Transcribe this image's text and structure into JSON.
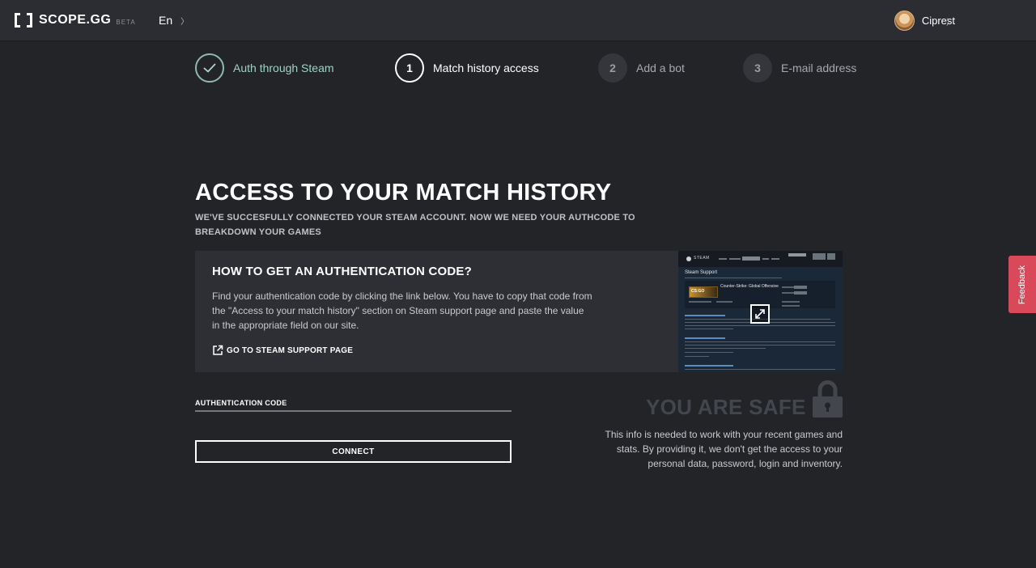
{
  "header": {
    "logo_text": "SCOPE.GG",
    "logo_badge": "BETA",
    "language": "En",
    "username": "Ciprest"
  },
  "steps": [
    {
      "number": "",
      "label": "Auth through Steam",
      "state": "done"
    },
    {
      "number": "1",
      "label": "Match history access",
      "state": "active"
    },
    {
      "number": "2",
      "label": "Add a bot",
      "state": "todo"
    },
    {
      "number": "3",
      "label": "E-mail address",
      "state": "todo"
    }
  ],
  "main": {
    "title": "ACCESS TO YOUR MATCH HISTORY",
    "subtitle": "WE'VE SUCCESFULLY CONNECTED YOUR STEAM ACCOUNT. NOW WE NEED YOUR AUTHCODE TO BREAKDOWN YOUR GAMES"
  },
  "card": {
    "title": "HOW TO GET AN AUTHENTICATION CODE?",
    "text": "Find your authentication code by clicking the link below. You have to copy that code from the \"Access to your match history\" section on Steam support page and paste the value in the appropriate field on our site.",
    "link_label": "GO TO STEAM SUPPORT PAGE",
    "preview": {
      "brand": "STEAM",
      "heading": "Steam Support",
      "game_badge": "CS:GO",
      "game_title": "Counter-Strike: Global Offensive"
    }
  },
  "form": {
    "label": "AUTHENTICATION CODE",
    "value": "",
    "button_label": "CONNECT"
  },
  "safe": {
    "title": "YOU ARE SAFE",
    "text": "This info is needed to work with your recent games and stats. By providing it, we don't get the access to your personal data, password, login and inventory."
  },
  "feedback": {
    "label": "Feedback"
  },
  "colors": {
    "background": "#222428",
    "topbar": "#2b2d32",
    "card": "#2d2f35",
    "step_done": "#9fd3c4",
    "feedback": "#d9495a"
  }
}
